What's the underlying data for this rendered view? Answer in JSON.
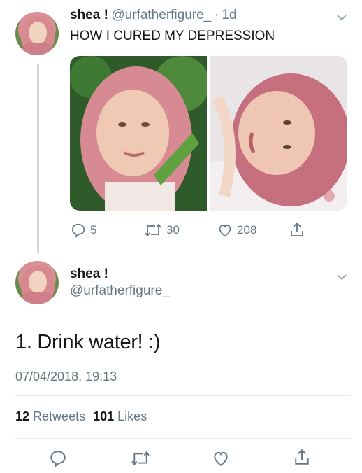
{
  "tweet1": {
    "display_name": "shea !",
    "handle": "@urfatherfigure_",
    "separator": "·",
    "time_ago": "1d",
    "text": "HOW I CURED MY DEPRESSION",
    "actions": {
      "replies": "5",
      "retweets": "30",
      "likes": "208"
    }
  },
  "tweet2": {
    "display_name": "shea !",
    "handle": "@urfatherfigure_",
    "text": "1. Drink water! :)",
    "timestamp": "07/04/2018, 19:13",
    "retweet_count": "12",
    "retweet_label": "Retweets",
    "like_count": "101",
    "like_label": "Likes"
  },
  "icons": {
    "reply": "reply-icon",
    "retweet": "retweet-icon",
    "like": "heart-icon",
    "share": "share-icon",
    "menu": "chevron-down-icon"
  },
  "colors": {
    "text": "#14171a",
    "secondary": "#657786",
    "divider": "#e6ecf0",
    "hair_pink": "#d7898f"
  }
}
